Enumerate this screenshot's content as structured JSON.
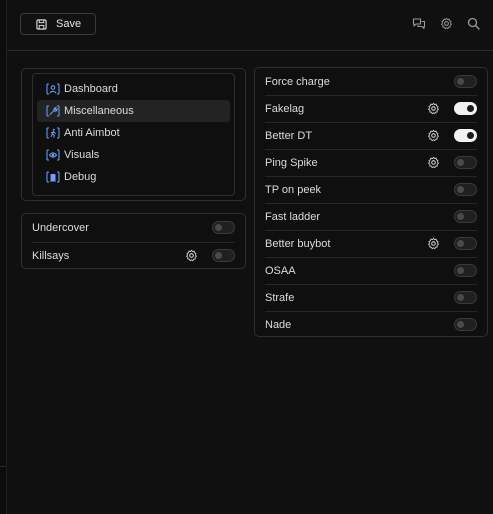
{
  "toolbar": {
    "save_label": "Save",
    "icons": [
      "chat-icon",
      "gear-icon",
      "search-icon"
    ]
  },
  "nav": {
    "items": [
      {
        "label": "Dashboard",
        "icon": "dashboard-icon",
        "active": false
      },
      {
        "label": "Miscellaneous",
        "icon": "wrench-icon",
        "active": true
      },
      {
        "label": "Anti Aimbot",
        "icon": "running-person-icon",
        "active": false
      },
      {
        "label": "Visuals",
        "icon": "eye-icon",
        "active": false
      },
      {
        "label": "Debug",
        "icon": "bug-icon",
        "active": false
      }
    ]
  },
  "misc": {
    "rows": [
      {
        "label": "Undercover",
        "has_settings": false,
        "enabled": false
      },
      {
        "label": "Killsays",
        "has_settings": true,
        "enabled": false
      }
    ]
  },
  "features": {
    "rows": [
      {
        "label": "Force charge",
        "has_settings": false,
        "enabled": false
      },
      {
        "label": "Fakelag",
        "has_settings": true,
        "enabled": true
      },
      {
        "label": "Better DT",
        "has_settings": true,
        "enabled": true
      },
      {
        "label": "Ping Spike",
        "has_settings": true,
        "enabled": false
      },
      {
        "label": "TP on peek",
        "has_settings": false,
        "enabled": false
      },
      {
        "label": "Fast ladder",
        "has_settings": false,
        "enabled": false
      },
      {
        "label": "Better buybot",
        "has_settings": true,
        "enabled": false
      },
      {
        "label": "OSAA",
        "has_settings": false,
        "enabled": false
      },
      {
        "label": "Strafe",
        "has_settings": false,
        "enabled": false
      },
      {
        "label": "Nade",
        "has_settings": false,
        "enabled": false
      }
    ]
  },
  "colors": {
    "background": "#101010",
    "border": "#2f2f2f",
    "toggle_on": "#f2f2f2",
    "nav_icon": "#6fa0ff"
  }
}
